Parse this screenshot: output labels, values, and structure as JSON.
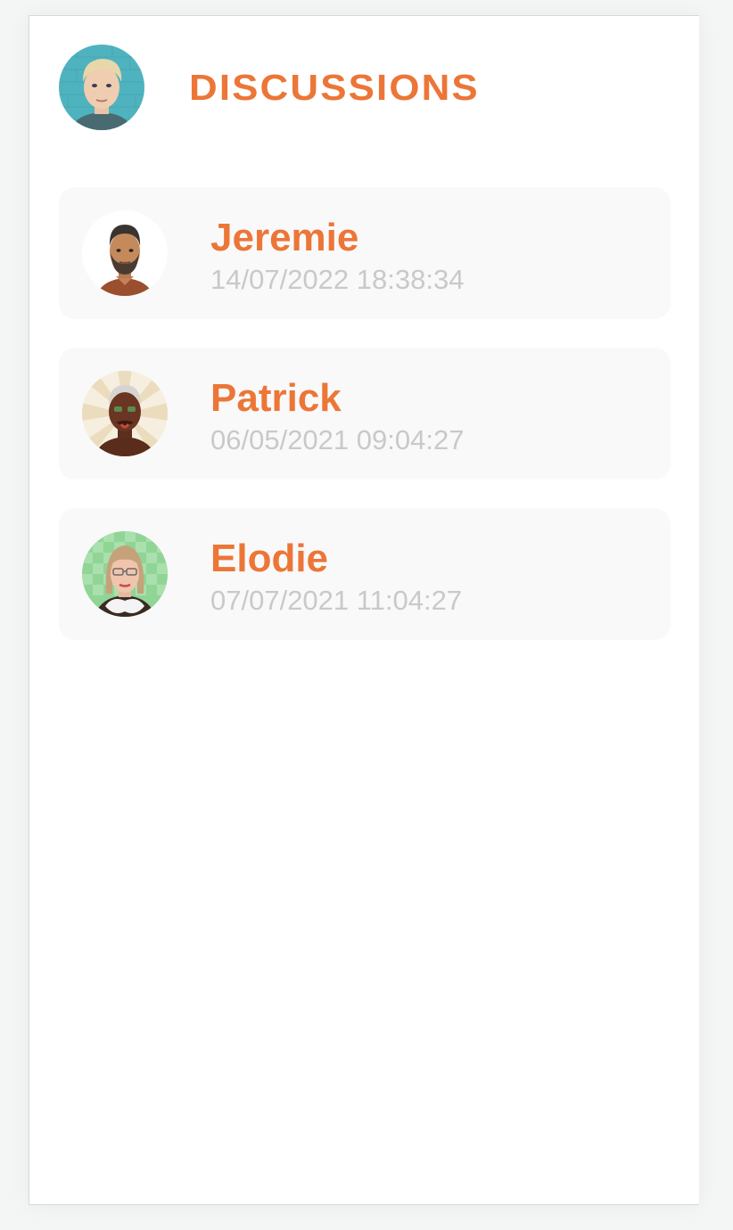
{
  "header": {
    "title": "DISCUSSIONS",
    "user_avatar_icon": "user-avatar-icon"
  },
  "conversations": [
    {
      "name": "Jeremie",
      "timestamp": "14/07/2022 18:38:34",
      "avatar_icon": "avatar-bearded-man-icon"
    },
    {
      "name": "Patrick",
      "timestamp": "06/05/2021 09:04:27",
      "avatar_icon": "avatar-grey-haired-man-icon"
    },
    {
      "name": "Elodie",
      "timestamp": "07/07/2021 11:04:27",
      "avatar_icon": "avatar-woman-glasses-icon"
    }
  ],
  "colors": {
    "accent": "#ec7637",
    "muted_text": "#c9c9c9",
    "card_background": "#f9f9f9",
    "page_background": "#ffffff"
  }
}
